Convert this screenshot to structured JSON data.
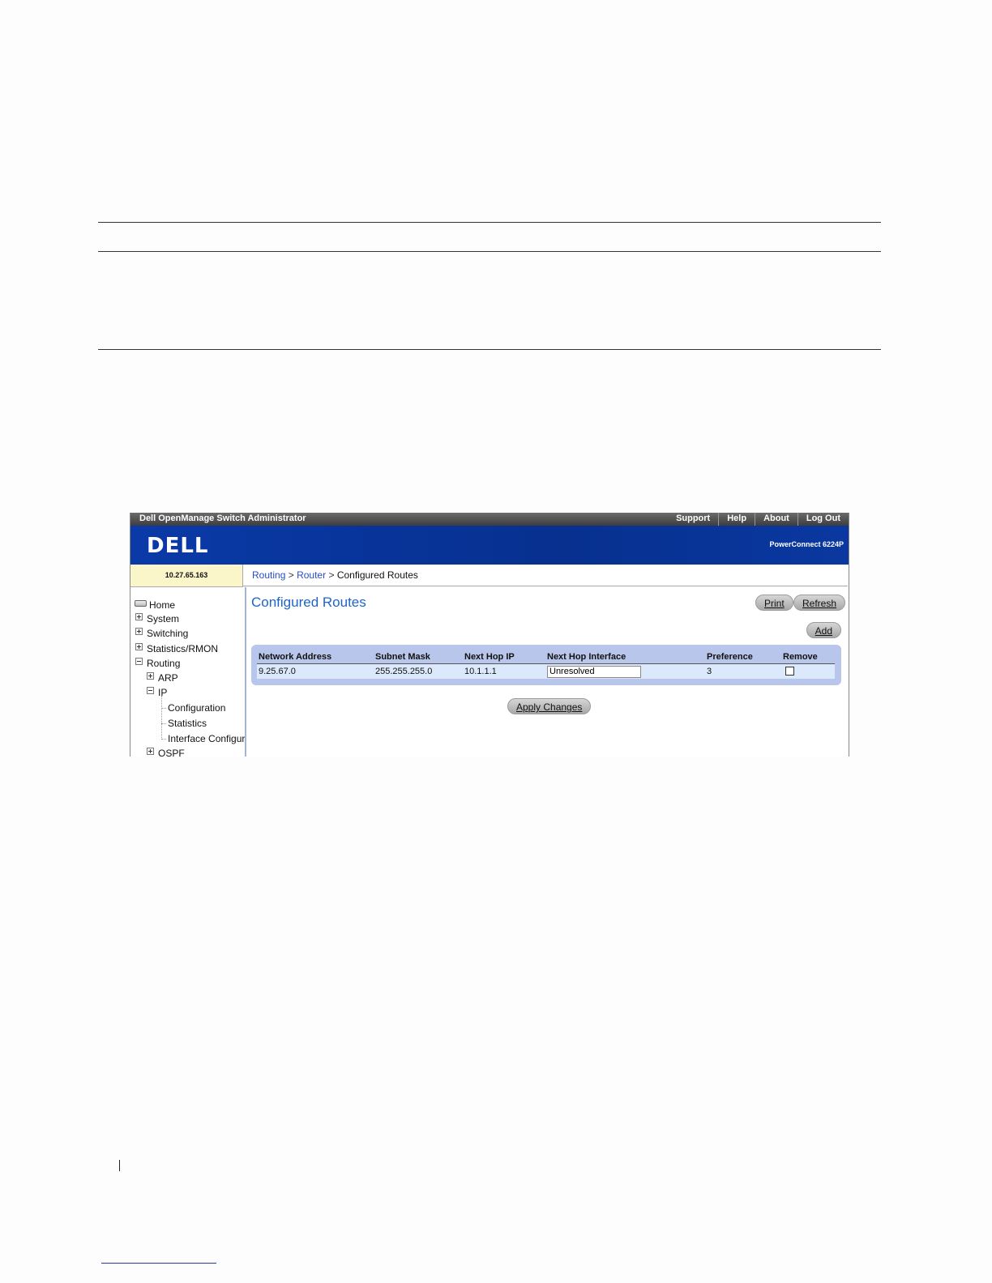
{
  "app": {
    "title": "Dell OpenManage Switch Administrator",
    "top_links": [
      "Support",
      "Help",
      "About",
      "Log Out"
    ],
    "logo_text": "DELL",
    "product": "PowerConnect 6224P",
    "ip_address": "10.27.65.163"
  },
  "breadcrumb": {
    "items": [
      "Routing",
      "Router",
      "Configured Routes"
    ],
    "separator": ">"
  },
  "sidebar": {
    "items": [
      {
        "label": "Home",
        "icon": "home-icon"
      },
      {
        "label": "System",
        "icon": "expand-plus-icon"
      },
      {
        "label": "Switching",
        "icon": "expand-plus-icon"
      },
      {
        "label": "Statistics/RMON",
        "icon": "expand-plus-icon"
      },
      {
        "label": "Routing",
        "icon": "collapse-minus-icon"
      },
      {
        "label": "ARP",
        "icon": "expand-plus-icon"
      },
      {
        "label": "IP",
        "icon": "collapse-minus-icon"
      },
      {
        "label": "Configuration"
      },
      {
        "label": "Statistics"
      },
      {
        "label": "Interface Configurati"
      },
      {
        "label": "OSPF",
        "icon": "expand-plus-icon"
      }
    ]
  },
  "main": {
    "title": "Configured Routes",
    "buttons": {
      "print": "Print",
      "refresh": "Refresh",
      "add": "Add",
      "apply": "Apply Changes"
    },
    "table": {
      "columns": [
        "Network Address",
        "Subnet Mask",
        "Next Hop IP",
        "Next Hop Interface",
        "Preference",
        "Remove"
      ],
      "rows": [
        {
          "network_address": "9.25.67.0",
          "subnet_mask": "255.255.255.0",
          "next_hop_ip": "10.1.1.1",
          "next_hop_interface": "Unresolved",
          "preference": "3",
          "remove": false
        }
      ]
    }
  },
  "colors": {
    "banner": "#07308f",
    "title_blue": "#1e64c8",
    "link_blue": "#2a4cc0",
    "table_panel": "#b9c6ec",
    "ip_box": "#fbf6c9"
  }
}
